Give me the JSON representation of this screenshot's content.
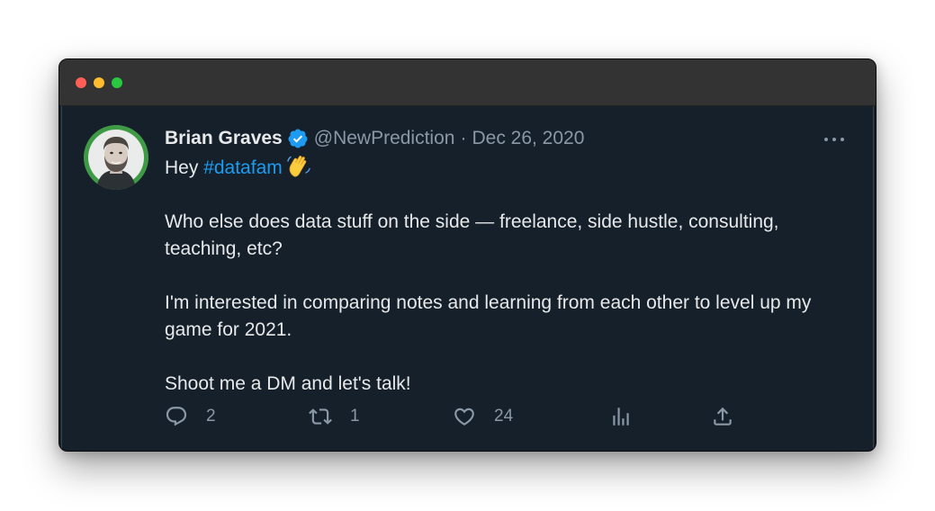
{
  "window": {
    "controls": [
      "close",
      "minimize",
      "maximize"
    ],
    "colors": {
      "close": "#ff5f57",
      "minimize": "#febc2e",
      "maximize": "#28c840"
    }
  },
  "tweet": {
    "author": {
      "name": "Brian Graves",
      "handle": "@NewPrediction",
      "verified": true,
      "avatar_icon": "profile-photo"
    },
    "separator": "·",
    "date": "Dec 26, 2020",
    "text": {
      "line1_prefix": "Hey ",
      "hashtag": "#datafam",
      "emoji_icon": "waving-hand-icon",
      "para2": "Who else does data stuff on the side — freelance, side hustle, consulting, teaching, etc?",
      "para3": "I'm interested in comparing notes and learning from each other to level up my game for 2021.",
      "para4": "Shoot me a DM and let's talk!"
    },
    "actions": {
      "reply": {
        "icon": "reply-icon",
        "count": "2"
      },
      "retweet": {
        "icon": "retweet-icon",
        "count": "1"
      },
      "like": {
        "icon": "heart-icon",
        "count": "24"
      },
      "analytics": {
        "icon": "analytics-icon"
      },
      "share": {
        "icon": "share-icon"
      }
    }
  },
  "colors": {
    "background": "#15202b",
    "text": "#e7e9ea",
    "muted": "#8b98a5",
    "accent": "#1d9bf0"
  }
}
